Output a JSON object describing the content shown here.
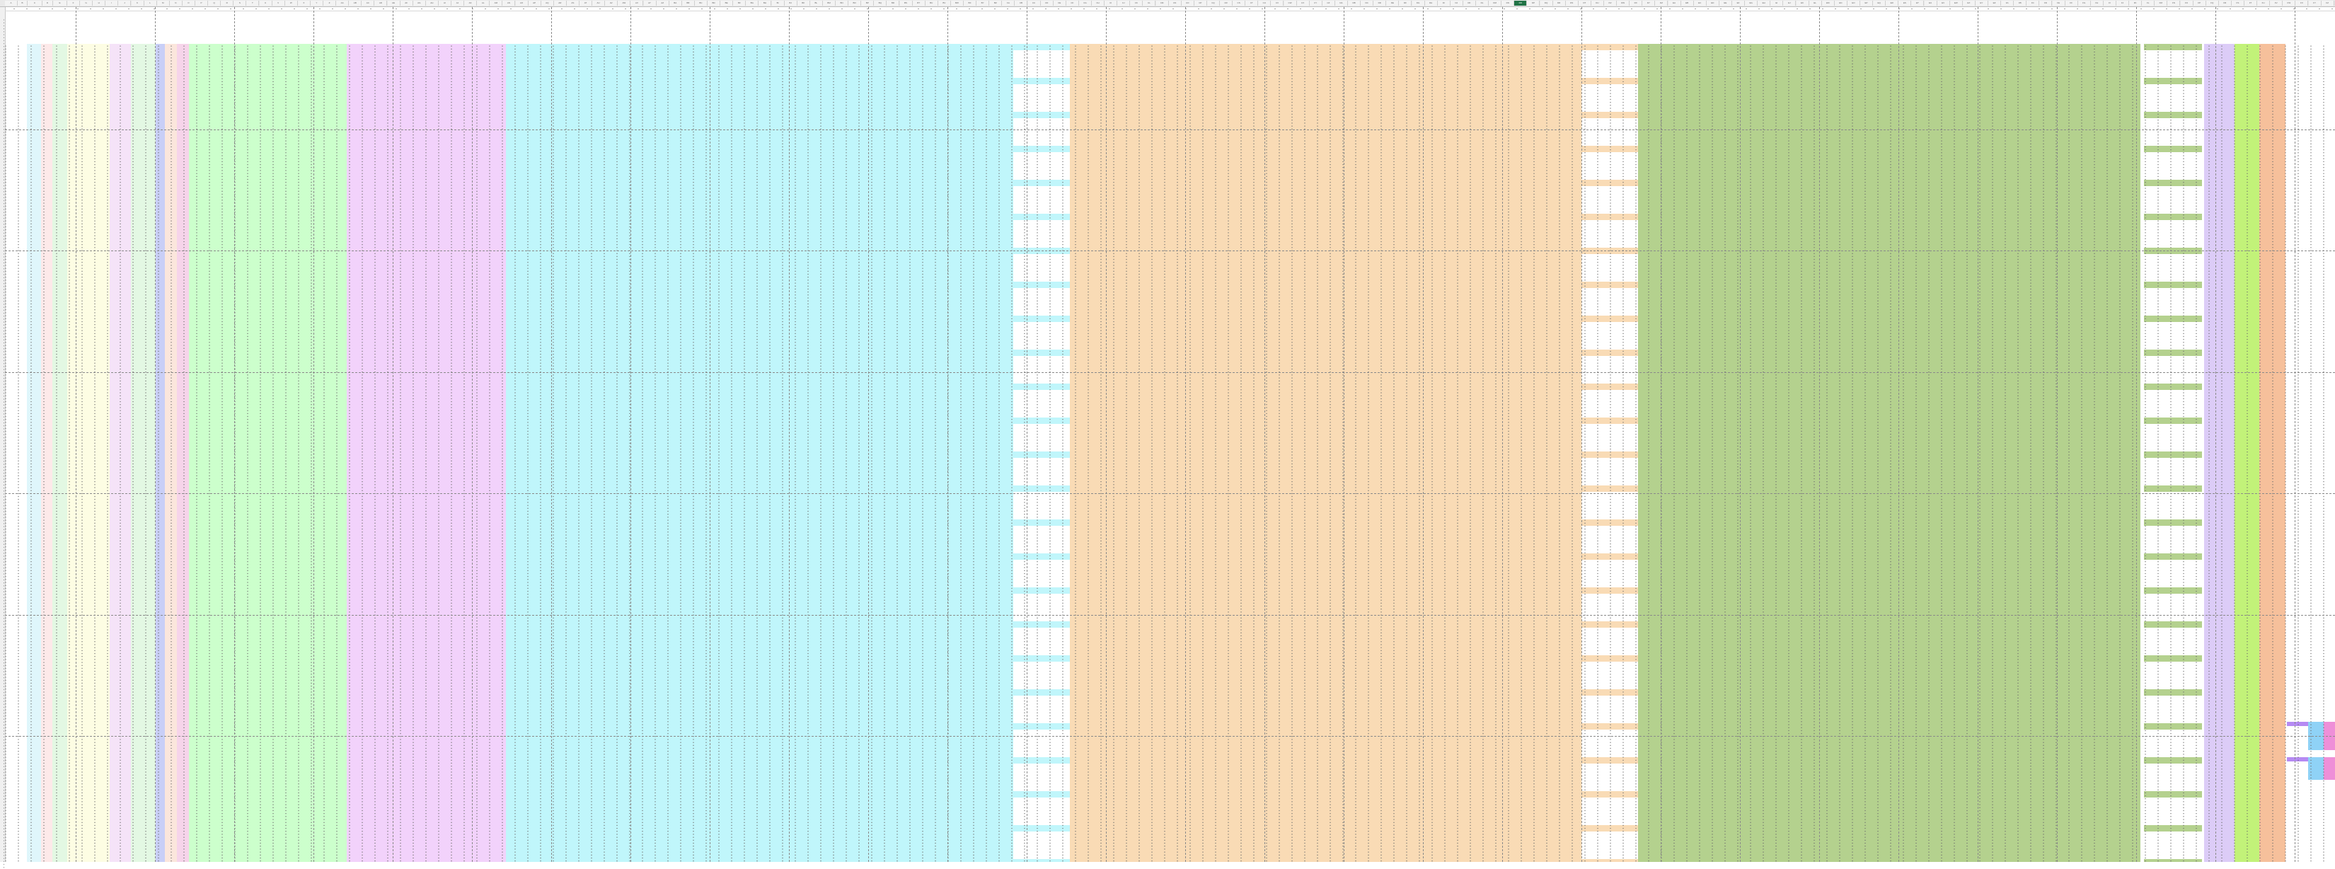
{
  "spreadsheet": {
    "selected_column": "DO",
    "column_headers": [
      "A",
      "B",
      "C",
      "D",
      "E",
      "F",
      "G",
      "H",
      "I",
      "J",
      "K",
      "L",
      "M",
      "N",
      "O",
      "P",
      "Q",
      "R",
      "S",
      "T",
      "U",
      "V",
      "W",
      "X",
      "Y",
      "Z",
      "AA",
      "AB",
      "AC",
      "AD",
      "AE",
      "AF",
      "AG",
      "AH",
      "AI",
      "AJ",
      "AK",
      "AL",
      "AM",
      "AN",
      "AO",
      "AP",
      "AQ",
      "AR",
      "AS",
      "AT",
      "AU",
      "AV",
      "AW",
      "AX",
      "AY",
      "AZ",
      "BA",
      "BB",
      "BC",
      "BD",
      "BE",
      "BF",
      "BG",
      "BH",
      "BI",
      "BJ",
      "BK",
      "BL",
      "BM",
      "BN",
      "BO",
      "BP",
      "BQ",
      "BR",
      "BS",
      "BT",
      "BU",
      "BV",
      "BW",
      "BX",
      "BY",
      "BZ",
      "CA",
      "CB",
      "CC",
      "CD",
      "CE",
      "CF",
      "CG",
      "CH",
      "CI",
      "CJ",
      "CK",
      "CL",
      "CM",
      "CN",
      "CO",
      "CP",
      "CQ",
      "CR",
      "CS",
      "CT",
      "CU",
      "CV",
      "CW",
      "CX",
      "CY",
      "CZ",
      "DA",
      "DB",
      "DC",
      "DD",
      "DE",
      "DF",
      "DG",
      "DH",
      "DI",
      "DJ",
      "DK",
      "DL",
      "DM",
      "DN",
      "DO",
      "DP",
      "DQ",
      "DR",
      "DS",
      "DT",
      "DU",
      "DV",
      "DW",
      "DX",
      "DY",
      "DZ",
      "EA",
      "EB",
      "EC",
      "ED",
      "EE",
      "EF",
      "EG",
      "EH",
      "EI",
      "EJ",
      "EK",
      "EL",
      "EM",
      "EN",
      "EO",
      "EP",
      "EQ",
      "ER",
      "ES",
      "ET",
      "EU",
      "EV",
      "EW",
      "EX",
      "EY",
      "EZ",
      "FA",
      "FB",
      "FC",
      "FD",
      "FE",
      "FF",
      "FG",
      "FH",
      "FI",
      "FJ",
      "FK",
      "FL",
      "FM",
      "FN",
      "FO",
      "FP",
      "FQ",
      "FR",
      "FS",
      "FT",
      "FU",
      "FV",
      "FW",
      "FX",
      "FY",
      "FZ"
    ],
    "colors": {
      "selected_header": "#217346",
      "cyan_light": "#dff6fb",
      "pink_light": "#fde9e9",
      "green_light": "#e3f8e3",
      "yellow_light": "#fdfde3",
      "pink_soft": "#f5e3f8",
      "blue_soft": "#c9cff7",
      "peach_soft": "#fbe6dc",
      "rose_soft": "#f6d4ea",
      "green": "#ccffcc",
      "violet": "#f2d2fb",
      "cyan": "#c0f6fb",
      "orange": "#f9dbb5",
      "olive": "#b4d18e",
      "lavender": "#dcccf7",
      "lime": "#c2f279",
      "salmon": "#f6c09b",
      "purple": "#b58af3",
      "sky": "#8fd2f6",
      "magenta": "#ee8fd8"
    }
  }
}
